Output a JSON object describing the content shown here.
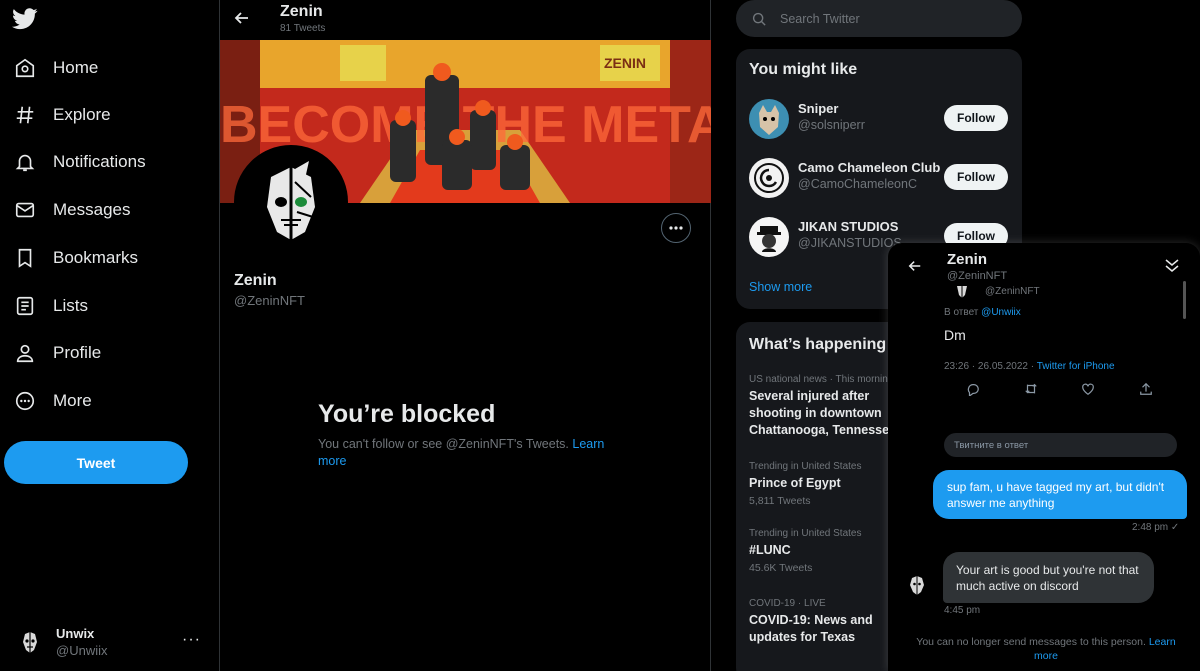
{
  "nav": {
    "items": [
      {
        "label": "Home",
        "icon": "home-icon"
      },
      {
        "label": "Explore",
        "icon": "hashtag-icon"
      },
      {
        "label": "Notifications",
        "icon": "bell-icon"
      },
      {
        "label": "Messages",
        "icon": "envelope-icon"
      },
      {
        "label": "Bookmarks",
        "icon": "bookmark-icon"
      },
      {
        "label": "Lists",
        "icon": "list-icon"
      },
      {
        "label": "Profile",
        "icon": "person-icon"
      },
      {
        "label": "More",
        "icon": "more-circle-icon"
      }
    ],
    "tweet_label": "Tweet",
    "account": {
      "name": "Unwix",
      "handle": "@Unwiix",
      "menu": "···"
    }
  },
  "profile": {
    "header_name": "Zenin",
    "tweet_count": "81 Tweets",
    "name": "Zenin",
    "handle": "@ZeninNFT",
    "banner_text": "BECOME THE META",
    "banner_sign": "ZENIN",
    "blocked_title": "You’re blocked",
    "blocked_text": "You can't follow or see @ZeninNFT's Tweets.",
    "blocked_link": "Learn more"
  },
  "search": {
    "placeholder": "Search Twitter"
  },
  "you_might_like": {
    "title": "You might like",
    "accounts": [
      {
        "name": "Sniper",
        "handle": "@solsniperr",
        "button": "Follow"
      },
      {
        "name": "Camo Chameleon Club",
        "handle": "@CamoChameleonC",
        "button": "Follow"
      },
      {
        "name": "JIKAN STUDIOS",
        "handle": "@JIKANSTUDIOS",
        "button": "Follow"
      }
    ],
    "show_more": "Show more"
  },
  "happening": {
    "title": "What’s happening",
    "trends": [
      {
        "meta": "US national news · This morning",
        "title": "Several injured after shooting in downtown Chattanooga, Tennessee",
        "count": ""
      },
      {
        "meta": "Trending in United States",
        "title": "Prince of Egypt",
        "count": "5,811 Tweets"
      },
      {
        "meta": "Trending in United States",
        "title": "#LUNC",
        "count": "45.6K Tweets"
      },
      {
        "meta": "COVID-19 · LIVE",
        "title": "COVID-19: News and updates for Texas",
        "count": ""
      }
    ]
  },
  "dm": {
    "name": "Zenin",
    "handle": "@ZeninNFT",
    "quoted_handle": "@ZeninNFT",
    "reply_prefix": "В ответ",
    "reply_to": "@Unwiix",
    "quoted_text": "Dm",
    "quoted_time": "23:26 · 26.05.2022 ·",
    "quoted_source": "Twitter for iPhone",
    "reply_placeholder": "Твитните в ответ",
    "outgoing": "sup fam, u have tagged my art, but didn't answer me anything",
    "outgoing_time": "2:48 pm ✓",
    "incoming": "Your art is good but you're not that much active on discord",
    "incoming_time": "4:45 pm",
    "footer_text": "You can no longer send messages to this person.",
    "footer_link": "Learn more"
  },
  "colors": {
    "accent": "#1d9bf0",
    "background": "#000000",
    "card": "#16181c",
    "muted": "#71767b"
  }
}
